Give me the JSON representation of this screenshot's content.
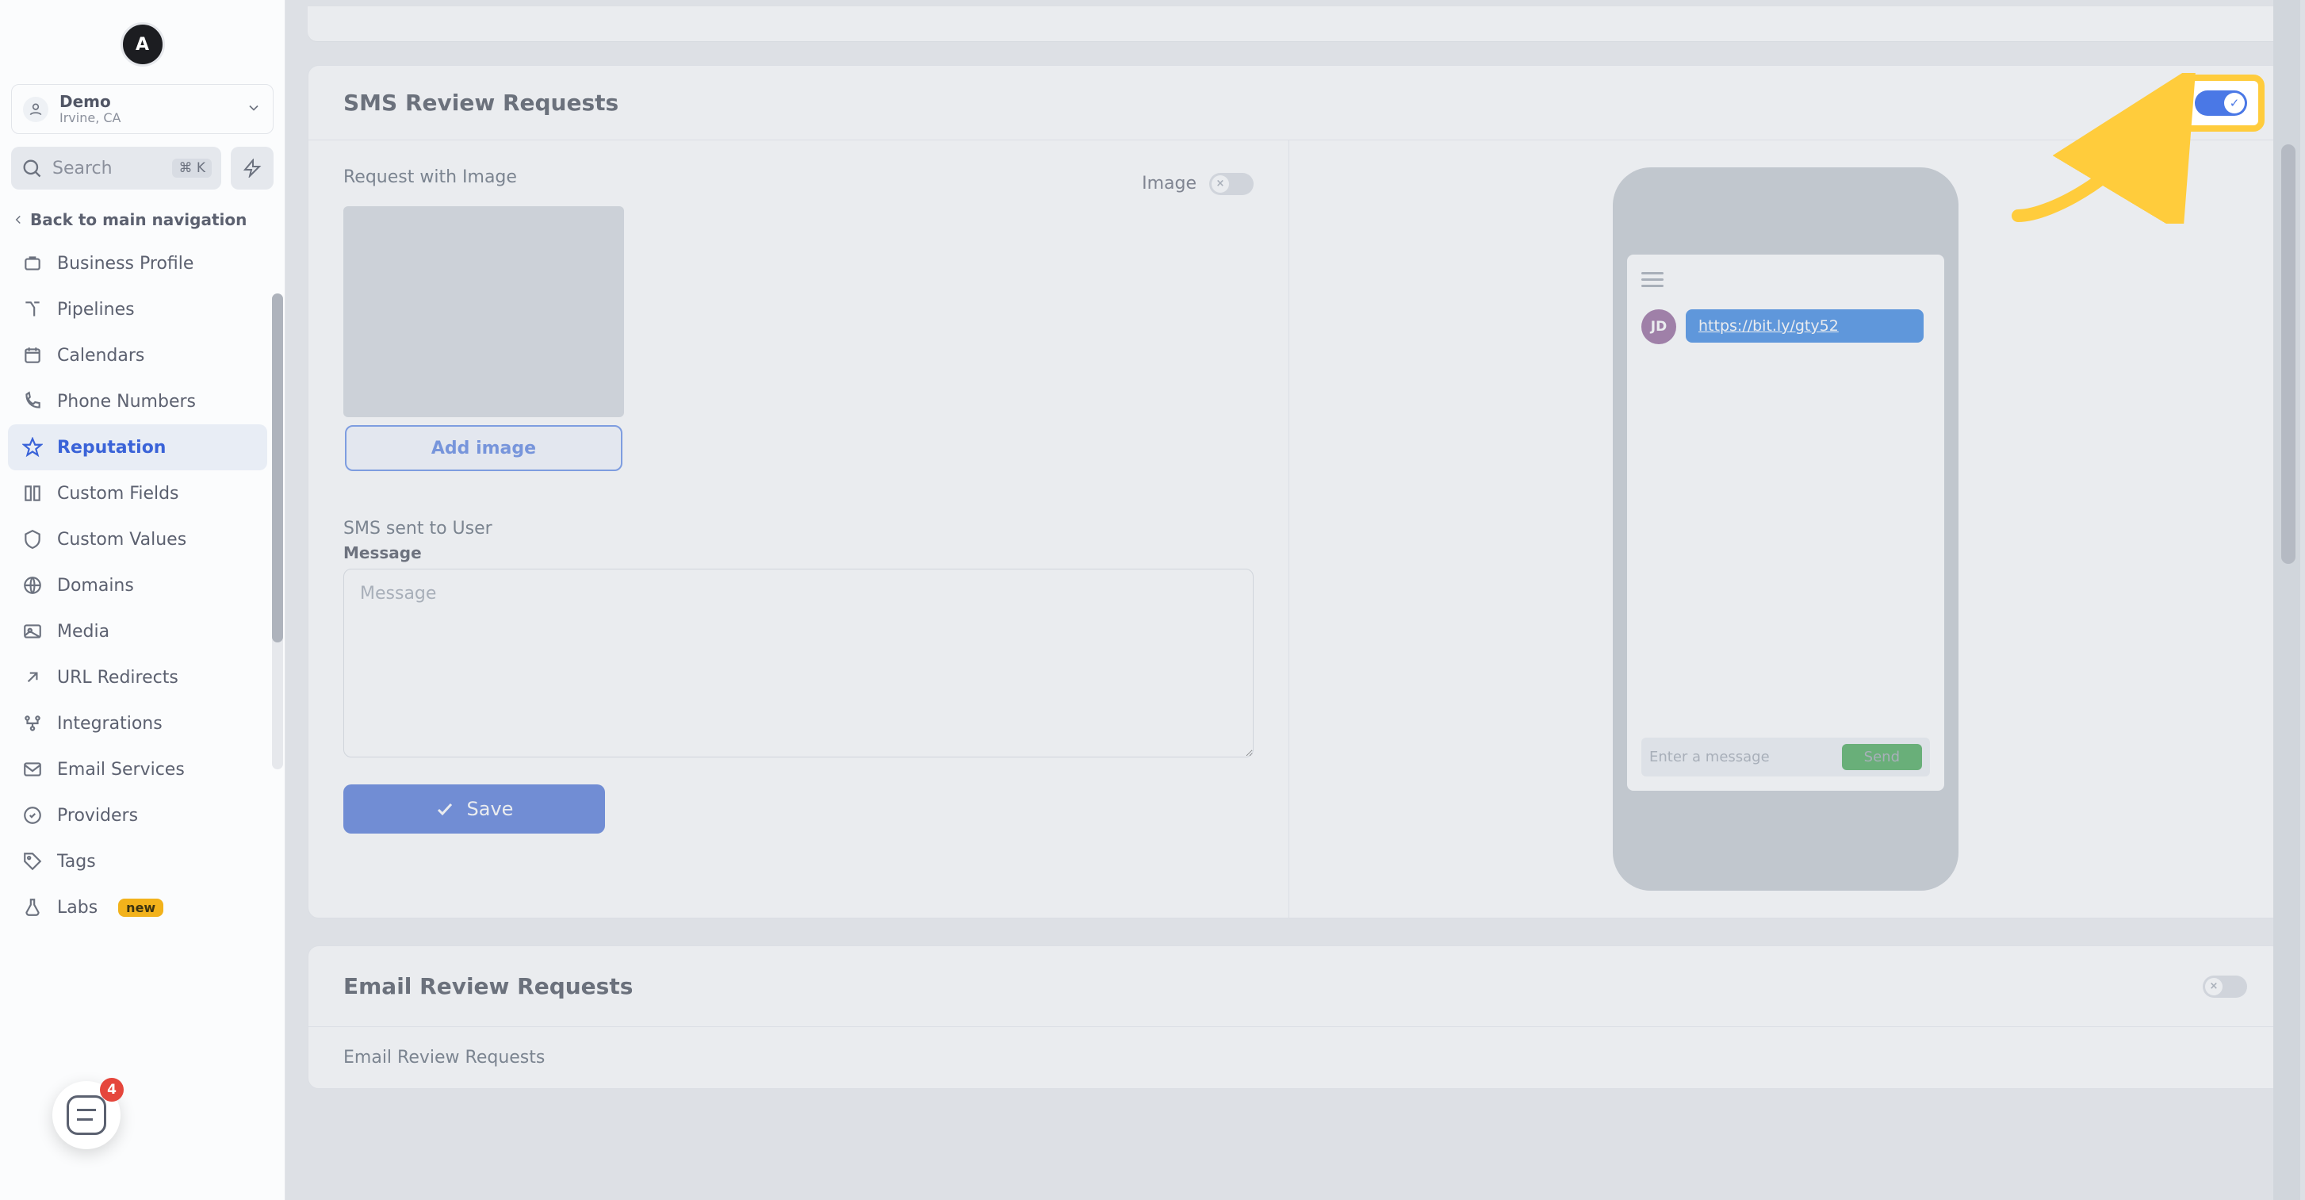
{
  "brand_letter": "A",
  "account": {
    "name": "Demo",
    "loc": "Irvine, CA"
  },
  "search": {
    "label": "Search",
    "shortcut": "⌘ K"
  },
  "back_label": "Back to main navigation",
  "nav": [
    {
      "key": "business-profile",
      "label": "Business Profile"
    },
    {
      "key": "pipelines",
      "label": "Pipelines"
    },
    {
      "key": "calendars",
      "label": "Calendars"
    },
    {
      "key": "phone-numbers",
      "label": "Phone Numbers"
    },
    {
      "key": "reputation",
      "label": "Reputation",
      "active": true
    },
    {
      "key": "custom-fields",
      "label": "Custom Fields"
    },
    {
      "key": "custom-values",
      "label": "Custom Values"
    },
    {
      "key": "domains",
      "label": "Domains"
    },
    {
      "key": "media",
      "label": "Media"
    },
    {
      "key": "url-redirects",
      "label": "URL Redirects"
    },
    {
      "key": "integrations",
      "label": "Integrations"
    },
    {
      "key": "email-services",
      "label": "Email Services"
    },
    {
      "key": "providers",
      "label": "Providers"
    },
    {
      "key": "tags",
      "label": "Tags"
    },
    {
      "key": "labs",
      "label": "Labs",
      "badge": "new"
    }
  ],
  "chat_badge": "4",
  "sms": {
    "title": "SMS Review Requests",
    "req_with_image": "Request with Image",
    "image_label": "Image",
    "add_image": "Add image",
    "sent_to_user": "SMS sent to User",
    "message_label": "Message",
    "message_placeholder": "Message",
    "save": "Save",
    "toggle_on": true
  },
  "preview": {
    "avatar": "JD",
    "link": "https://bit.ly/gty52",
    "compose_placeholder": "Enter a message",
    "send": "Send"
  },
  "email": {
    "title": "Email Review Requests",
    "sub": "Email Review Requests"
  },
  "colors": {
    "accent": "#4a78e6",
    "highlight": "#ffcc3c",
    "send": "#3aa24a"
  }
}
